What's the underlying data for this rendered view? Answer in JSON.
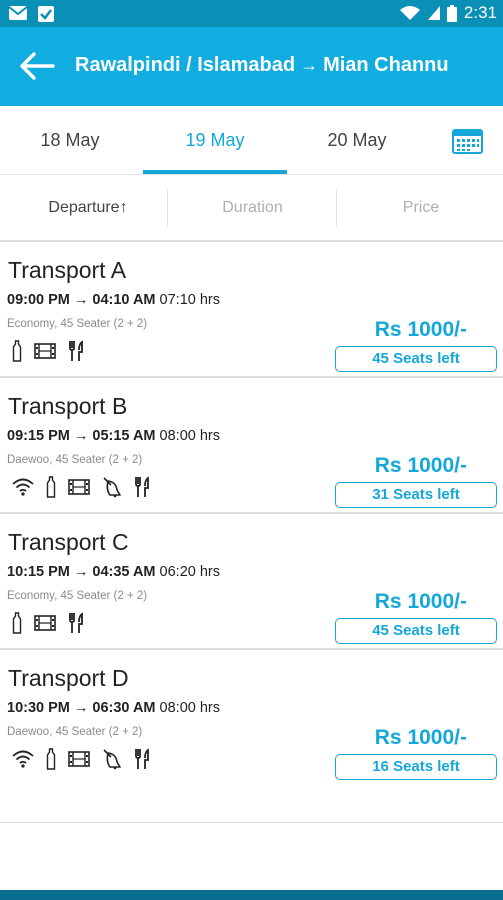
{
  "status": {
    "time": "2:31"
  },
  "header": {
    "from": "Rawalpindi / Islamabad",
    "arrow": "→",
    "to": "Mian Channu"
  },
  "dates": {
    "tabs": [
      "18 May",
      "19 May",
      "20 May"
    ],
    "active": "19 May"
  },
  "sort": {
    "departure": "Departure↑",
    "duration": "Duration",
    "price": "Price"
  },
  "theme": {
    "accent": "#13a8d9",
    "header": "#12ade0",
    "statusbar": "#0a8fb6"
  },
  "results": [
    {
      "name": "Transport A",
      "depart": "09:00 PM",
      "arrive": "04:10 AM",
      "duration": "07:10 hrs",
      "bus": "Economy, 45 Seater (2 + 2)",
      "price": "Rs 1000/-",
      "seats": "45 Seats left",
      "amenities": [
        "water-bottle-icon",
        "film-icon",
        "fork-knife-icon"
      ]
    },
    {
      "name": "Transport B",
      "depart": "09:15 PM",
      "arrive": "05:15 AM",
      "duration": "08:00 hrs",
      "bus": "Daewoo, 45 Seater (2 + 2)",
      "price": "Rs 1000/-",
      "seats": "31 Seats left",
      "amenities": [
        "wifi-icon",
        "water-bottle-icon",
        "film-icon",
        "hostess-bell-icon",
        "fork-knife-icon"
      ]
    },
    {
      "name": "Transport C",
      "depart": "10:15 PM",
      "arrive": "04:35 AM",
      "duration": "06:20 hrs",
      "bus": "Economy, 45 Seater (2 + 2)",
      "price": "Rs 1000/-",
      "seats": "45 Seats left",
      "amenities": [
        "water-bottle-icon",
        "film-icon",
        "fork-knife-icon"
      ]
    },
    {
      "name": "Transport D",
      "depart": "10:30 PM",
      "arrive": "06:30 AM",
      "duration": "08:00 hrs",
      "bus": "Daewoo, 45 Seater (2 + 2)",
      "price": "Rs 1000/-",
      "seats": "16 Seats left",
      "amenities": [
        "wifi-icon",
        "water-bottle-icon",
        "film-icon",
        "hostess-bell-icon",
        "fork-knife-icon"
      ]
    }
  ]
}
